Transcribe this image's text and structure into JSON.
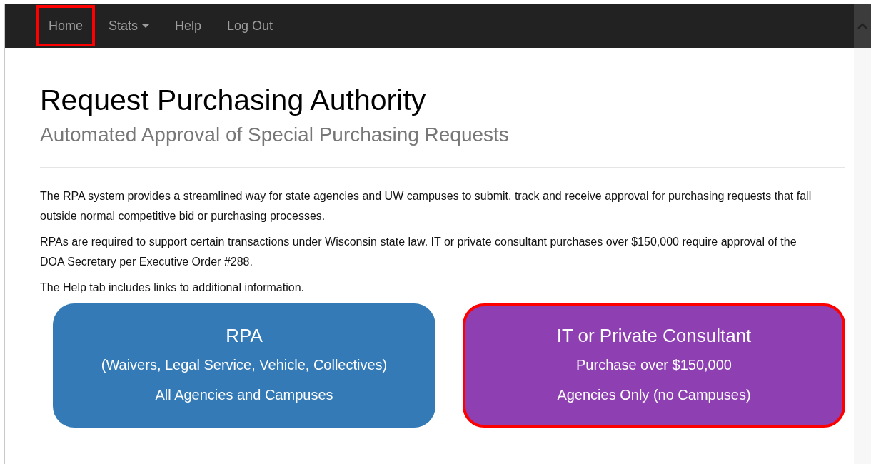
{
  "navbar": {
    "items": [
      {
        "label": "Home",
        "dropdown": false,
        "highlighted": true
      },
      {
        "label": "Stats",
        "dropdown": true,
        "highlighted": false
      },
      {
        "label": "Help",
        "dropdown": false,
        "highlighted": false
      },
      {
        "label": "Log Out",
        "dropdown": false,
        "highlighted": false
      }
    ]
  },
  "header": {
    "title": "Request Purchasing Authority",
    "subtitle": "Automated Approval of Special Purchasing Requests"
  },
  "paragraphs": [
    "The RPA system provides a streamlined way for state agencies and UW campuses to submit, track and receive approval for purchasing requests that fall outside normal competitive bid or purchasing processes.",
    "RPAs are required to support certain transactions under Wisconsin state law. IT or private consultant purchases over $150,000 require approval of the DOA Secretary per Executive Order #288.",
    "The Help tab includes links to additional information."
  ],
  "cards": [
    {
      "title": "RPA",
      "lines": [
        "(Waivers, Legal Service, Vehicle, Collectives)",
        "All Agencies and Campuses"
      ],
      "color": "#337ab7",
      "highlighted": false
    },
    {
      "title": "IT or Private Consultant",
      "lines": [
        "Purchase over $150,000",
        "Agencies Only (no Campuses)"
      ],
      "color": "#8e3fb1",
      "highlighted": true
    }
  ]
}
